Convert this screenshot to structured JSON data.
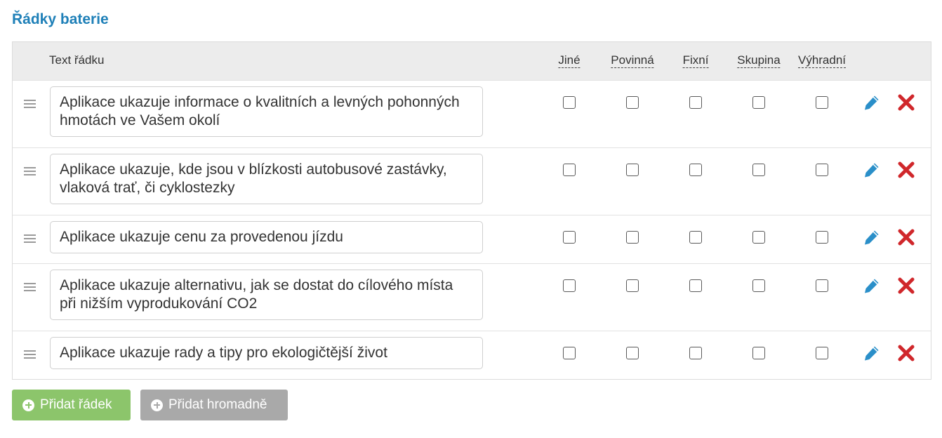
{
  "section": {
    "title": "Řádky baterie"
  },
  "table": {
    "header": {
      "text": "Text řádku",
      "options": [
        "Jiné",
        "Povinná",
        "Fixní",
        "Skupina",
        "Výhradní"
      ]
    },
    "rows": [
      {
        "text": "Aplikace ukazuje informace o kvalitních a levných pohonných hmotách ve Vašem okolí"
      },
      {
        "text": "Aplikace ukazuje, kde jsou v blízkosti autobusové zastávky, vlaková trať, či cyklostezky"
      },
      {
        "text": "Aplikace ukazuje cenu za provedenou jízdu"
      },
      {
        "text": "Aplikace ukazuje alternativu, jak se dostat do cílového místa při nižším vyprodukování CO2"
      },
      {
        "text": "Aplikace ukazuje rady a tipy pro ekologičtější život"
      }
    ]
  },
  "buttons": {
    "add_row": "Přidat řádek",
    "add_bulk": "Přidat hromadně"
  },
  "icons": {
    "drag": "drag-handle-icon",
    "edit": "pencil-icon",
    "delete": "delete-x-icon",
    "add": "plus-circle-icon"
  },
  "colors": {
    "title": "#1f80b8",
    "edit": "#2a8fc9",
    "delete": "#d0272b",
    "add_button": "#8cc56b",
    "bulk_button": "#a9a9a9"
  }
}
